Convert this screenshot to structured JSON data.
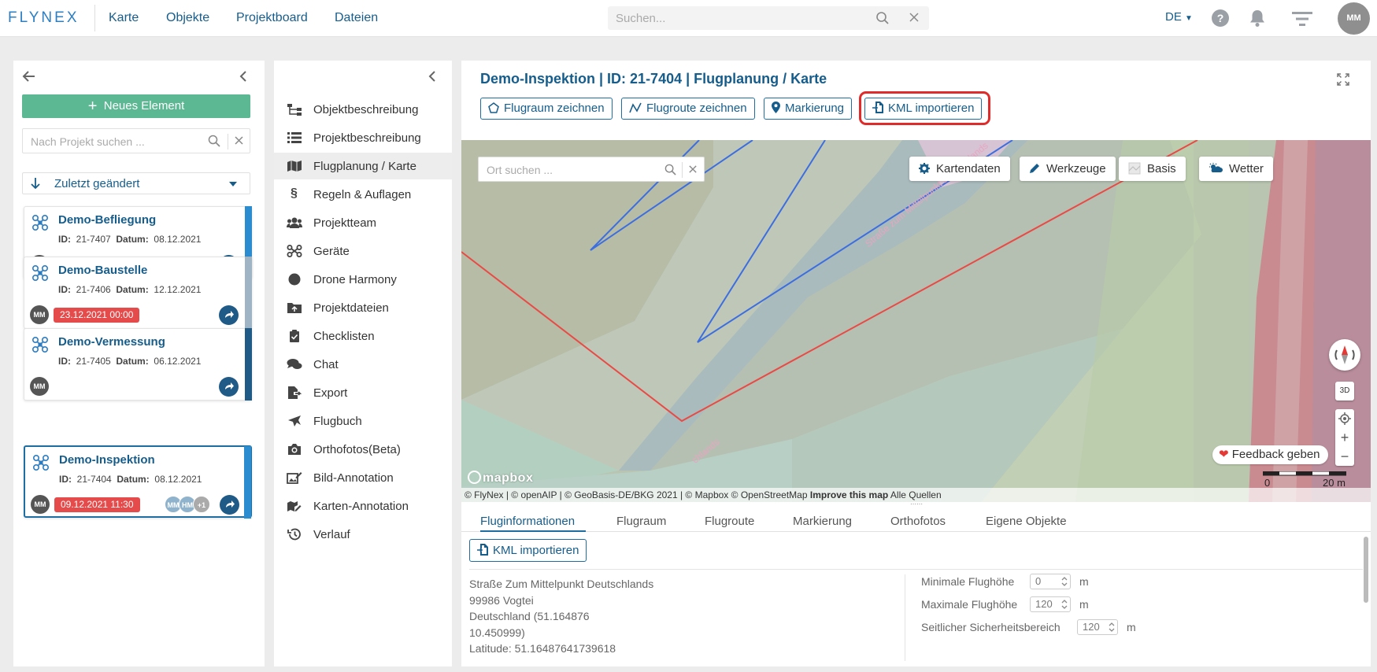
{
  "app": {
    "logo": "FLYNEX"
  },
  "nav": {
    "items": [
      "Karte",
      "Objekte",
      "Projektboard",
      "Dateien"
    ]
  },
  "global_search": {
    "placeholder": "Suchen..."
  },
  "header": {
    "language": "DE",
    "help": "?",
    "user_initials": "MM"
  },
  "projects_panel": {
    "new_button": "Neues Element",
    "search_placeholder": "Nach Projekt suchen ...",
    "sort_label": "Zuletzt geändert",
    "cards": [
      {
        "title": "Demo-Befliegung",
        "id_label": "ID:",
        "id": "21-7407",
        "date_label": "Datum:",
        "date": "08.12.2021",
        "owner": "MM",
        "due": "",
        "color": "#2c8cd0"
      },
      {
        "title": "Demo-Baustelle",
        "id_label": "ID:",
        "id": "21-7406",
        "date_label": "Datum:",
        "date": "12.12.2021",
        "owner": "MM",
        "due": "23.12.2021 00:00",
        "color": "#9fb5c5"
      },
      {
        "title": "Demo-Vermessung",
        "id_label": "ID:",
        "id": "21-7405",
        "date_label": "Datum:",
        "date": "06.12.2021",
        "owner": "MM",
        "due": "",
        "color": "#1f5b86"
      },
      {
        "title": "Demo-Inspektion",
        "id_label": "ID:",
        "id": "21-7404",
        "date_label": "Datum:",
        "date": "08.12.2021",
        "owner": "MM",
        "due": "09.12.2021 11:30",
        "color": "#2c8cd0",
        "members": [
          "MM",
          "HM",
          "+1"
        ]
      }
    ]
  },
  "side_menu": {
    "items": [
      {
        "label": "Objektbeschreibung",
        "icon": "sitemap-icon"
      },
      {
        "label": "Projektbeschreibung",
        "icon": "list-icon"
      },
      {
        "label": "Flugplanung / Karte",
        "icon": "map-icon",
        "active": true
      },
      {
        "label": "Regeln & Auflagen",
        "icon": "paragraph-icon"
      },
      {
        "label": "Projektteam",
        "icon": "team-icon"
      },
      {
        "label": "Geräte",
        "icon": "drone-icon"
      },
      {
        "label": "Drone Harmony",
        "icon": "circle-icon"
      },
      {
        "label": "Projektdateien",
        "icon": "folder-icon"
      },
      {
        "label": "Checklisten",
        "icon": "clipboard-icon"
      },
      {
        "label": "Chat",
        "icon": "chat-icon"
      },
      {
        "label": "Export",
        "icon": "export-icon"
      },
      {
        "label": "Flugbuch",
        "icon": "plane-icon"
      },
      {
        "label": "Orthofotos(Beta)",
        "icon": "camera-icon"
      },
      {
        "label": "Bild-Annotation",
        "icon": "image-edit-icon"
      },
      {
        "label": "Karten-Annotation",
        "icon": "map-edit-icon"
      },
      {
        "label": "Verlauf",
        "icon": "history-icon"
      }
    ]
  },
  "main": {
    "title": "Demo-Inspektion | ID: 21-7404 | Flugplanung / Karte",
    "toolbar": {
      "flugraum": "Flugraum zeichnen",
      "flugroute": "Flugroute zeichnen",
      "markierung": "Markierung",
      "kml": "KML importieren"
    },
    "map": {
      "search_placeholder": "Ort suchen ...",
      "buttons": {
        "kartendaten": "Kartendaten",
        "werkzeuge": "Werkzeuge",
        "basis": "Basis",
        "wetter": "Wetter"
      },
      "street_label": "Straße zum Mittelpunkt Deutschlands",
      "street_label_2": "chlands",
      "feedback": "Feedback geben",
      "mapbox": "mapbox",
      "three_d": "3D",
      "scale": {
        "start": "0",
        "end": "20 m"
      },
      "attribution": "© FlyNex | © openAIP | © GeoBasis-DE/BKG 2021 | © Mapbox © OpenStreetMap",
      "improve": "Improve this map",
      "sources": "Alle Quellen"
    },
    "tabs": [
      "Fluginformationen",
      "Flugraum",
      "Flugroute",
      "Markierung",
      "Orthofotos",
      "Eigene Objekte"
    ],
    "info": {
      "kml_button": "KML importieren",
      "address_lines": [
        "Straße Zum Mittelpunkt Deutschlands",
        "99986 Vogtei",
        "Deutschland (51.164876",
        "10.450999)",
        "Latitude: 51.16487641739618"
      ],
      "min_alt_label": "Minimale Flughöhe",
      "min_alt": "0",
      "max_alt_label": "Maximale Flughöhe",
      "max_alt": "120",
      "safety_label": "Seitlicher Sicherheitsbereich",
      "safety": "120",
      "unit": "m"
    }
  },
  "colors": {
    "primary": "#165d8c",
    "accent_green": "#5cb893",
    "alert_red": "#e54b4b",
    "highlight": "#e02b2b"
  }
}
